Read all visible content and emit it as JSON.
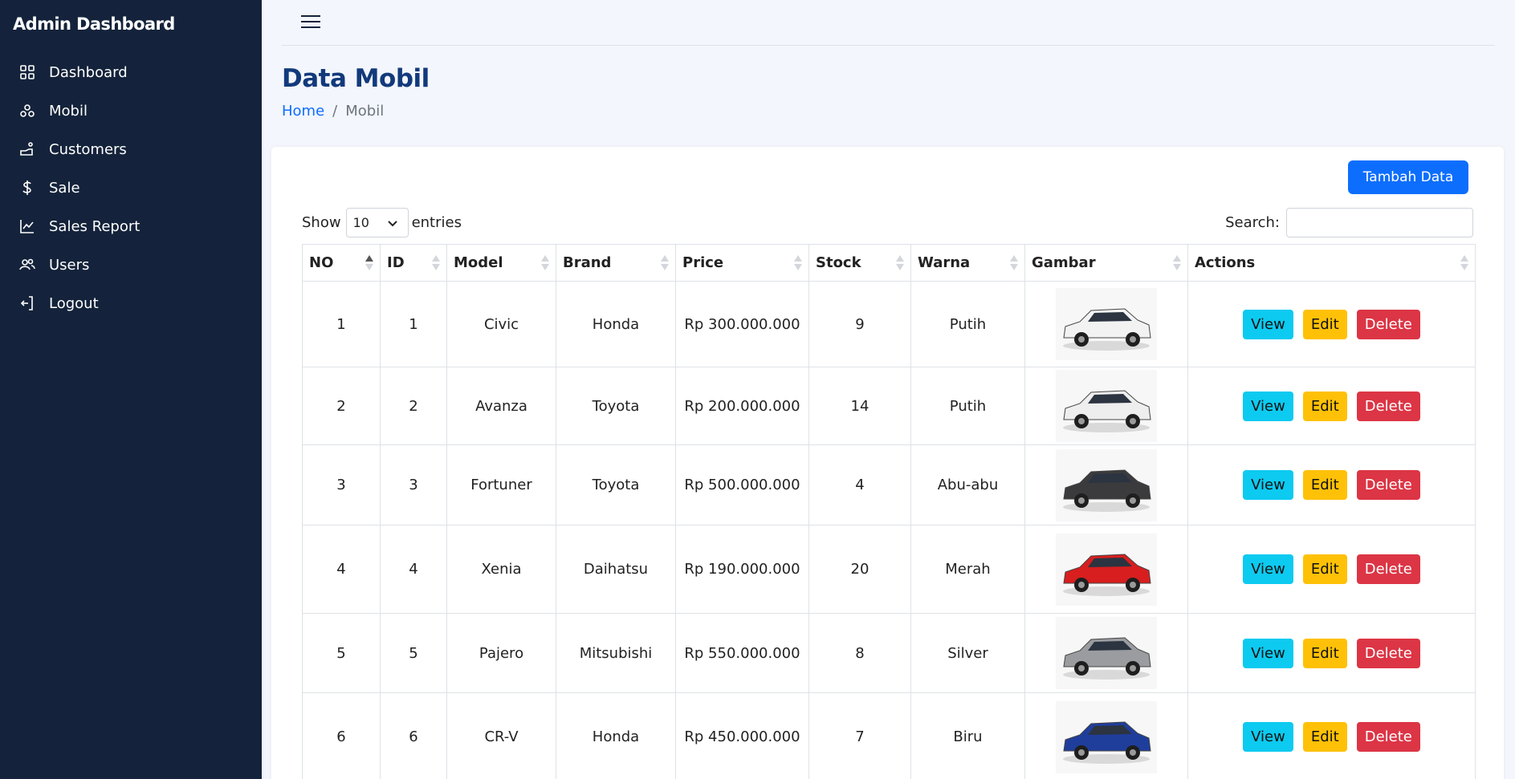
{
  "sidebar": {
    "brand": "Admin Dashboard",
    "items": [
      {
        "label": "Dashboard",
        "icon": "grid-icon"
      },
      {
        "label": "Mobil",
        "icon": "car-icon"
      },
      {
        "label": "Customers",
        "icon": "customers-icon"
      },
      {
        "label": "Sale",
        "icon": "dollar-icon"
      },
      {
        "label": "Sales Report",
        "icon": "chart-icon"
      },
      {
        "label": "Users",
        "icon": "users-icon"
      },
      {
        "label": "Logout",
        "icon": "logout-icon"
      }
    ]
  },
  "header": {
    "title": "Data Mobil",
    "breadcrumb": {
      "home": "Home",
      "separator": "/",
      "current": "Mobil"
    }
  },
  "toolbar": {
    "add_label": "Tambah Data"
  },
  "table_controls": {
    "show_label": "Show",
    "entries_value": "10",
    "entries_label": "entries",
    "search_label": "Search:",
    "search_value": ""
  },
  "table": {
    "columns": [
      "NO",
      "ID",
      "Model",
      "Brand",
      "Price",
      "Stock",
      "Warna",
      "Gambar",
      "Actions"
    ],
    "rows": [
      {
        "no": "1",
        "id": "1",
        "model": "Civic",
        "brand": "Honda",
        "price": "Rp 300.000.000",
        "stock": "9",
        "warna": "Putih",
        "car_color": "#f2f2f2"
      },
      {
        "no": "2",
        "id": "2",
        "model": "Avanza",
        "brand": "Toyota",
        "price": "Rp 200.000.000",
        "stock": "14",
        "warna": "Putih",
        "car_color": "#eeeeee"
      },
      {
        "no": "3",
        "id": "3",
        "model": "Fortuner",
        "brand": "Toyota",
        "price": "Rp 500.000.000",
        "stock": "4",
        "warna": "Abu-abu",
        "car_color": "#3b3b3d"
      },
      {
        "no": "4",
        "id": "4",
        "model": "Xenia",
        "brand": "Daihatsu",
        "price": "Rp 190.000.000",
        "stock": "20",
        "warna": "Merah",
        "car_color": "#d81e1e"
      },
      {
        "no": "5",
        "id": "5",
        "model": "Pajero",
        "brand": "Mitsubishi",
        "price": "Rp 550.000.000",
        "stock": "8",
        "warna": "Silver",
        "car_color": "#9a9ca0"
      },
      {
        "no": "6",
        "id": "6",
        "model": "CR-V",
        "brand": "Honda",
        "price": "Rp 450.000.000",
        "stock": "7",
        "warna": "Biru",
        "car_color": "#1f3e9c"
      }
    ],
    "actions": {
      "view": "View",
      "edit": "Edit",
      "delete": "Delete"
    }
  },
  "colors": {
    "sidebar_bg": "#14233b",
    "title": "#123a7b",
    "primary": "#0d6efd",
    "info": "#0dcaf0",
    "warning": "#ffc107",
    "danger": "#dc3545"
  }
}
